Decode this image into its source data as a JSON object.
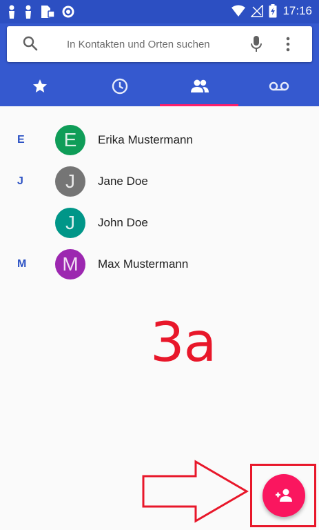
{
  "status_bar": {
    "time": "17:16",
    "left_icons": [
      "person-icon",
      "person-icon",
      "sim-icon",
      "sync-icon"
    ],
    "right_icons": [
      "wifi-icon",
      "no-signal-icon",
      "battery-charging-icon"
    ]
  },
  "search": {
    "placeholder": "In Kontakten und Orten suchen",
    "icons": [
      "search-icon",
      "mic-icon",
      "more-vert-icon"
    ]
  },
  "tabs": [
    {
      "icon": "star-icon",
      "name": "favorites",
      "selected": false
    },
    {
      "icon": "clock-icon",
      "name": "recents",
      "selected": false
    },
    {
      "icon": "contacts-icon",
      "name": "contacts",
      "selected": true
    },
    {
      "icon": "voicemail-icon",
      "name": "voicemail",
      "selected": false
    }
  ],
  "contacts": [
    {
      "section_letter": "E",
      "initial": "E",
      "name": "Erika Mustermann",
      "avatar_color": "#0f9d58"
    },
    {
      "section_letter": "J",
      "initial": "J",
      "name": "Jane Doe",
      "avatar_color": "#757575"
    },
    {
      "section_letter": "",
      "initial": "J",
      "name": "John Doe",
      "avatar_color": "#009688"
    },
    {
      "section_letter": "M",
      "initial": "M",
      "name": "Max Mustermann",
      "avatar_color": "#9c27b0"
    }
  ],
  "annotation": {
    "label": "3a",
    "color": "#e8172a"
  },
  "fab": {
    "icon": "add-person-icon",
    "color": "#fa165f"
  },
  "colors": {
    "primary": "#3559cf",
    "status_bar": "#2c4fc2",
    "accent": "#ff1e6a",
    "section_letter": "#2c52c4"
  }
}
